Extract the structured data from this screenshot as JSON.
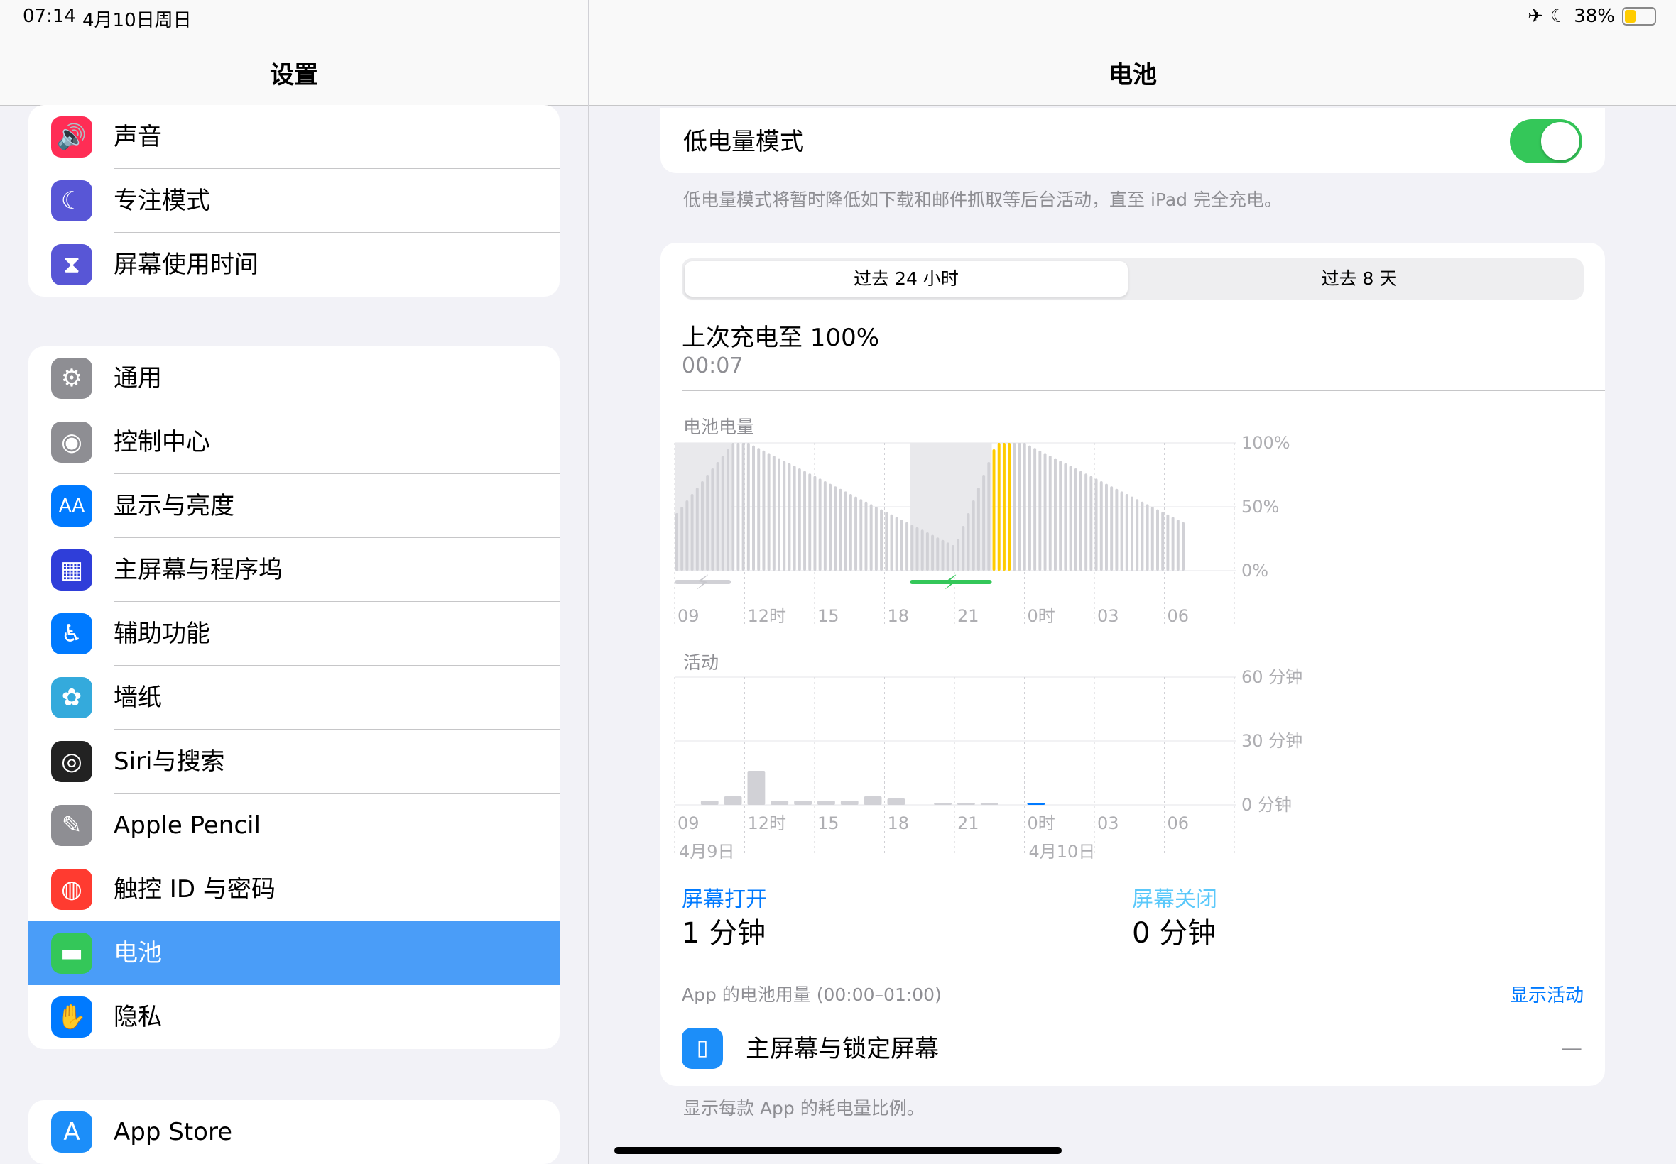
{
  "status": {
    "time": "07:14",
    "date": "4月10日周日",
    "battery_pct": "38%",
    "battery_level": 0.38
  },
  "sidebar": {
    "title": "设置",
    "groups": [
      [
        {
          "label": "声音",
          "icon": "speaker-icon",
          "color": "#ff2d55",
          "glyph": "🔊"
        },
        {
          "label": "专注模式",
          "icon": "moon-icon",
          "color": "#5856d6",
          "glyph": "☾"
        },
        {
          "label": "屏幕使用时间",
          "icon": "hourglass-icon",
          "color": "#5856d6",
          "glyph": "⧗"
        }
      ],
      [
        {
          "label": "通用",
          "icon": "gear-icon",
          "color": "#8e8e93",
          "glyph": "⚙"
        },
        {
          "label": "控制中心",
          "icon": "toggles-icon",
          "color": "#8e8e93",
          "glyph": "◉"
        },
        {
          "label": "显示与亮度",
          "icon": "text-size-icon",
          "color": "#007aff",
          "glyph": "AA"
        },
        {
          "label": "主屏幕与程序坞",
          "icon": "home-grid-icon",
          "color": "#2f3ed9",
          "glyph": "▦"
        },
        {
          "label": "辅助功能",
          "icon": "accessibility-icon",
          "color": "#007aff",
          "glyph": "♿"
        },
        {
          "label": "墙纸",
          "icon": "flower-icon",
          "color": "#34aadc",
          "glyph": "✿"
        },
        {
          "label": "Siri与搜索",
          "icon": "siri-icon",
          "color": "#222222",
          "glyph": "◎"
        },
        {
          "label": "Apple Pencil",
          "icon": "pencil-icon",
          "color": "#8e8e93",
          "glyph": "✎"
        },
        {
          "label": "触控 ID 与密码",
          "icon": "fingerprint-icon",
          "color": "#ff3b30",
          "glyph": "◍"
        },
        {
          "label": "电池",
          "icon": "battery-icon",
          "color": "#34c759",
          "glyph": "▬",
          "selected": true
        },
        {
          "label": "隐私",
          "icon": "hand-icon",
          "color": "#007aff",
          "glyph": "✋"
        }
      ],
      [
        {
          "label": "App Store",
          "icon": "app-store-icon",
          "color": "#1c8ef9",
          "glyph": "A"
        }
      ]
    ]
  },
  "main": {
    "title": "电池",
    "low_power": {
      "label": "低电量模式",
      "on": true,
      "footer": "低电量模式将暂时降低如下载和邮件抓取等后台活动，直至 iPad 完全充电。"
    },
    "segments": {
      "active": "过去 24 小时",
      "inactive": "过去 8 天"
    },
    "last_charge": {
      "title": "上次充电至 100%",
      "time": "00:07"
    },
    "battery_chart_title": "电池电量",
    "activity_chart_title": "活动",
    "screen_on": {
      "label": "屏幕打开",
      "value": "1 分钟"
    },
    "screen_off": {
      "label": "屏幕关闭",
      "value": "0 分钟"
    },
    "usage": {
      "label": "App 的电池用量 (00:00–01:00)",
      "action": "显示活动"
    },
    "app_row": {
      "label": "主屏幕与锁定屏幕",
      "value": "—"
    },
    "footer": "显示每款 App 的耗电量比例。"
  },
  "chart_data": [
    {
      "type": "bar",
      "title": "电池电量",
      "x_ticks": [
        "09",
        "12时",
        "15",
        "18",
        "21",
        "0时",
        "03",
        "06"
      ],
      "y_ticks": [
        "100%",
        "50%",
        "0%"
      ],
      "ylim": [
        0,
        100
      ],
      "values": [
        45,
        50,
        55,
        60,
        65,
        70,
        75,
        80,
        85,
        90,
        95,
        100,
        100,
        100,
        100,
        98,
        96,
        94,
        92,
        90,
        88,
        86,
        84,
        82,
        80,
        78,
        76,
        74,
        72,
        70,
        68,
        66,
        64,
        62,
        60,
        58,
        56,
        54,
        52,
        50,
        48,
        46,
        44,
        42,
        40,
        38,
        36,
        34,
        32,
        30,
        28,
        26,
        24,
        22,
        20,
        25,
        35,
        45,
        55,
        65,
        75,
        85,
        95,
        100,
        100,
        100,
        100,
        100,
        100,
        98,
        96,
        94,
        92,
        90,
        88,
        86,
        84,
        82,
        80,
        78,
        76,
        74,
        72,
        70,
        68,
        66,
        64,
        62,
        60,
        58,
        56,
        54,
        52,
        50,
        48,
        46,
        44,
        42,
        40,
        38
      ],
      "charging_intervals": [
        [
          0,
          11
        ],
        [
          46,
          62
        ]
      ],
      "low_power_start": 62,
      "low_power_end": 66
    },
    {
      "type": "bar",
      "title": "活动",
      "x_ticks": [
        "09",
        "12时",
        "15",
        "18",
        "21",
        "0时",
        "03",
        "06"
      ],
      "date_labels": [
        "4月9日",
        "4月10日"
      ],
      "y_ticks": [
        "60 分钟",
        "30 分钟",
        "0 分钟"
      ],
      "ylim": [
        0,
        60
      ],
      "values": [
        0,
        2,
        4,
        16,
        2,
        2,
        2,
        2,
        4,
        3,
        0,
        1,
        1,
        1,
        0,
        1,
        0,
        0,
        0,
        0,
        0,
        0,
        0,
        0
      ],
      "highlight_index": 15
    }
  ]
}
